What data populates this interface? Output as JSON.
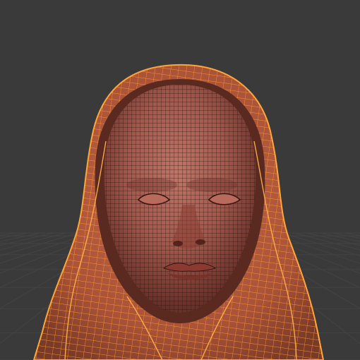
{
  "viewport": {
    "background_color": "#3a3a3a",
    "grid_color": "#454545",
    "grid_axis_color": "#4a4a4a",
    "grid_visible": true
  },
  "model": {
    "skin_color": "#a4574a",
    "skin_shadow_color": "#6a2f27",
    "skin_highlight_color": "#c27566",
    "wire_color": "#20100c",
    "cloth_color": "#b35a3e",
    "cloth_wire_color": "#ff9a2a",
    "selected": true
  }
}
